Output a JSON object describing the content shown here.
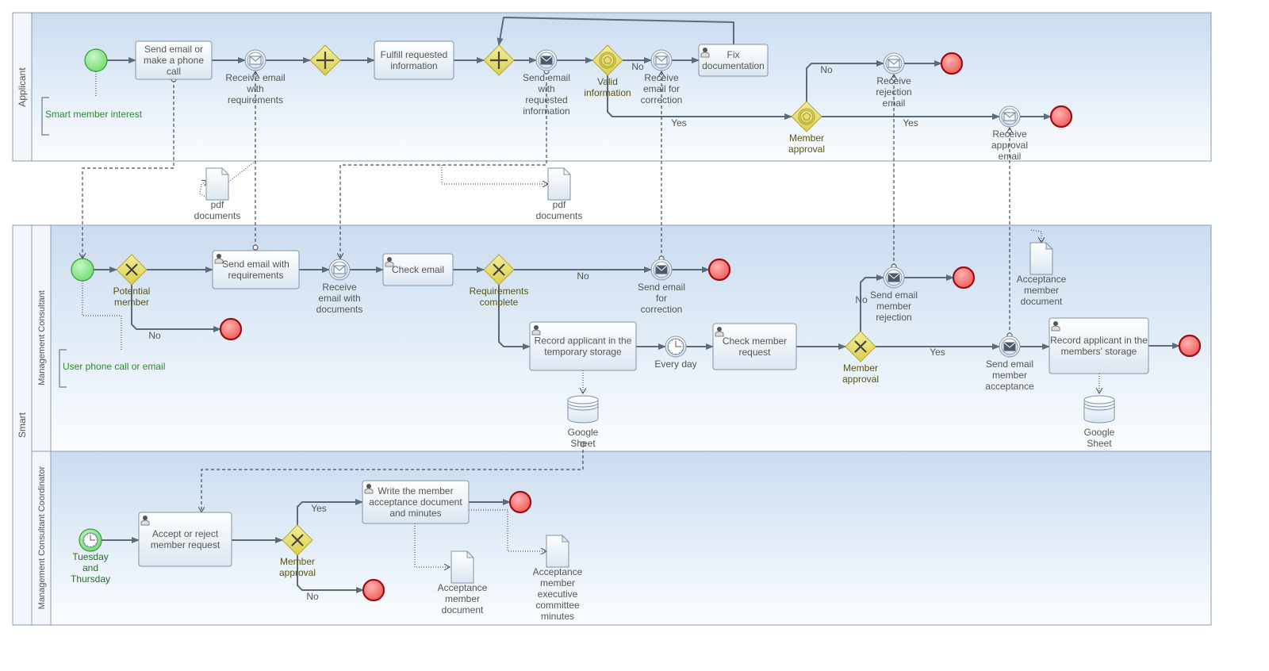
{
  "pools": {
    "applicant": {
      "label": "Applicant"
    },
    "smart": {
      "label": "Smart"
    }
  },
  "lanes": {
    "consultant": {
      "label": "Management Consultant"
    },
    "coordinator": {
      "label": "Management Consultant Coordinator"
    }
  },
  "colors": {
    "start_fill": "#8ee88e",
    "end_fill": "#f47a7a",
    "end_stroke": "#9a1010",
    "gateway_fill": "#e6de6a",
    "pool_band": "#cfdff0",
    "annotation_text": "#2e8b2e"
  },
  "nodes": {
    "a_start": {
      "type": "start-event",
      "label": ""
    },
    "a_send_contact": {
      "type": "task",
      "label": "Send email or\nmake a phone\ncall"
    },
    "a_recv_req": {
      "type": "message-catch-event",
      "label": "Receive email\nwith\nrequirements"
    },
    "a_and1": {
      "type": "parallel-gateway",
      "label": ""
    },
    "a_fulfill": {
      "type": "task",
      "label": "Fulfill requested\ninformation"
    },
    "a_and2": {
      "type": "parallel-gateway",
      "label": ""
    },
    "a_send_info": {
      "type": "message-throw-event",
      "label": "Send email\nwith\nrequested\ninformation"
    },
    "a_valid": {
      "type": "event-gateway",
      "label": "Valid\ninformation"
    },
    "a_recv_corr": {
      "type": "message-catch-event",
      "label": "Receive\nemail for\ncorrection"
    },
    "a_fix": {
      "type": "user-task",
      "label": "Fix\ndocumentation"
    },
    "a_approval": {
      "type": "event-gateway",
      "label": "Member\napproval"
    },
    "a_recv_rej": {
      "type": "message-catch-event",
      "label": "Receive\nrejection\nemail"
    },
    "a_end_rej": {
      "type": "end-event",
      "label": ""
    },
    "a_recv_appr": {
      "type": "message-catch-event",
      "label": "Receive\napproval\nemail"
    },
    "a_end_appr": {
      "type": "end-event",
      "label": ""
    },
    "pdf1": {
      "type": "data-object",
      "label": "pdf\ndocuments"
    },
    "pdf2": {
      "type": "data-object",
      "label": "pdf\ndocuments"
    },
    "c_start": {
      "type": "start-event",
      "label": ""
    },
    "c_potential": {
      "type": "exclusive-gateway",
      "label": "Potential\nmember"
    },
    "c_end_no": {
      "type": "end-event",
      "label": ""
    },
    "c_send_req": {
      "type": "user-task",
      "label": "Send email with\nrequirements"
    },
    "c_recv_docs": {
      "type": "message-catch-event",
      "label": "Receive\nemail with\ndocuments"
    },
    "c_check_email": {
      "type": "user-task",
      "label": "Check email"
    },
    "c_req_complete": {
      "type": "exclusive-gateway",
      "label": "Requirements\ncomplete"
    },
    "c_send_corr": {
      "type": "message-throw-event",
      "label": "Send email\nfor\ncorrection"
    },
    "c_end_corr": {
      "type": "end-event",
      "label": ""
    },
    "c_record_temp": {
      "type": "user-task",
      "label": "Record applicant in the\ntemporary storage"
    },
    "c_timer": {
      "type": "timer-event",
      "label": "Every day"
    },
    "c_check_req": {
      "type": "user-task",
      "label": "Check member\nrequest"
    },
    "c_approval": {
      "type": "exclusive-gateway",
      "label": "Member\napproval"
    },
    "c_send_rej": {
      "type": "message-throw-event",
      "label": "Send email\nmember\nrejection"
    },
    "c_end_rej": {
      "type": "end-event",
      "label": ""
    },
    "c_send_acc": {
      "type": "message-throw-event",
      "label": "Send email\nmember\nacceptance"
    },
    "c_record_members": {
      "type": "user-task",
      "label": "Record applicant in the\nmembers' storage"
    },
    "c_end_final": {
      "type": "end-event",
      "label": ""
    },
    "c_sheet1": {
      "type": "data-store",
      "label": "Google\nSheet"
    },
    "c_sheet2": {
      "type": "data-store",
      "label": "Google\nSheet"
    },
    "c_acc_doc": {
      "type": "data-object",
      "label": "Acceptance\nmember\ndocument"
    },
    "k_start": {
      "type": "timer-start-event",
      "label": "Tuesday\nand\nThursday"
    },
    "k_accept": {
      "type": "user-task",
      "label": "Accept or reject\nmember request"
    },
    "k_approval": {
      "type": "exclusive-gateway",
      "label": "Member\napproval"
    },
    "k_write": {
      "type": "user-task",
      "label": "Write the member\nacceptance document\nand minutes"
    },
    "k_end_yes": {
      "type": "end-event",
      "label": ""
    },
    "k_end_no": {
      "type": "end-event",
      "label": ""
    },
    "k_doc1": {
      "type": "data-object",
      "label": "Acceptance\nmember\ndocument"
    },
    "k_doc2": {
      "type": "data-object",
      "label": "Acceptance\nmember\nexecutive\ncommittee\nminutes"
    }
  },
  "annotations": {
    "smart_interest": "Smart member interest",
    "user_contact": "User phone call or email"
  },
  "flow_labels": {
    "valid_no": "No",
    "valid_yes": "Yes",
    "a_approval_no": "No",
    "a_approval_yes": "Yes",
    "potential_no": "No",
    "req_no": "No",
    "c_approval_no": "No",
    "c_approval_yes": "Yes",
    "k_yes": "Yes",
    "k_no": "No"
  }
}
